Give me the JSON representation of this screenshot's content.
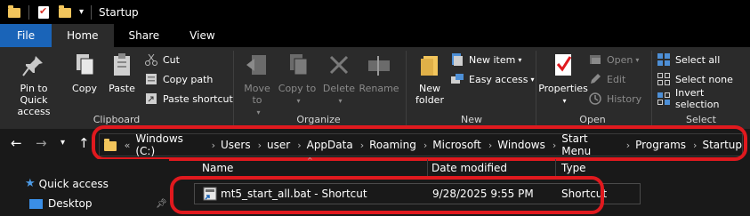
{
  "window": {
    "title": "Startup"
  },
  "tabs": [
    "File",
    "Home",
    "Share",
    "View"
  ],
  "ribbon": {
    "clipboard": {
      "label": "Clipboard",
      "pin_quick_access": "Pin to Quick access",
      "copy": "Copy",
      "paste": "Paste",
      "cut": "Cut",
      "copy_path": "Copy path",
      "paste_shortcut": "Paste shortcut"
    },
    "organize": {
      "label": "Organize",
      "move_to": "Move to",
      "copy_to": "Copy to",
      "delete": "Delete",
      "rename": "Rename"
    },
    "new": {
      "label": "New",
      "new_folder": "New folder",
      "new_item": "New item",
      "easy_access": "Easy access"
    },
    "open": {
      "label": "Open",
      "properties": "Properties",
      "open": "Open",
      "edit": "Edit",
      "history": "History"
    },
    "select": {
      "label": "Select",
      "select_all": "Select all",
      "select_none": "Select none",
      "invert_selection": "Invert selection"
    }
  },
  "address": {
    "overflow": "«",
    "crumbs": [
      "Windows (C:)",
      "Users",
      "user",
      "AppData",
      "Roaming",
      "Microsoft",
      "Windows",
      "Start Menu",
      "Programs",
      "Startup"
    ]
  },
  "navpane": {
    "quick_access": "Quick access",
    "desktop": "Desktop"
  },
  "columns": {
    "name": "Name",
    "date_modified": "Date modified",
    "type": "Type"
  },
  "files": [
    {
      "name": "mt5_start_all.bat - Shortcut",
      "date": "9/28/2025 9:55 PM",
      "type": "Shortcut"
    }
  ],
  "colors": {
    "highlight": "#e0191e",
    "file_tab": "#1a64b8",
    "folder": "#f2c55c"
  }
}
